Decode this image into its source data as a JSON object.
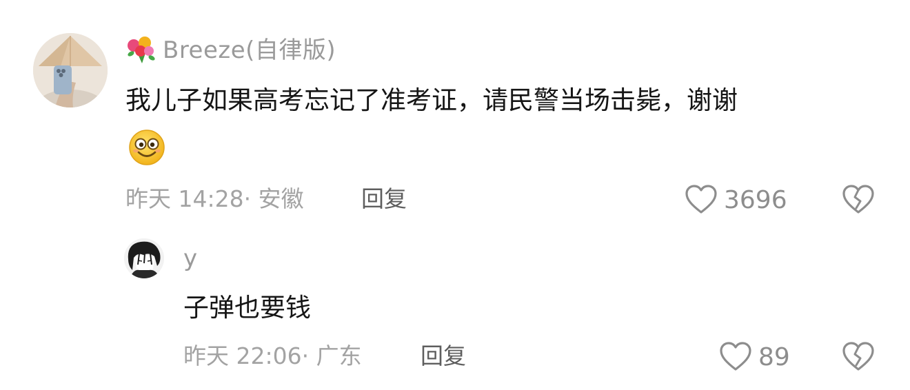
{
  "comment": {
    "username": "Breeze(自律版)",
    "badge_icon": "flower-bouquet-icon",
    "text": "我儿子如果高考忘记了准考证，请民警当场击毙，谢谢",
    "emoji_icon": "smiley-face-icon",
    "time": "昨天 14:28",
    "location": "· 安徽",
    "reply_label": "回复",
    "like_count": "3696",
    "like_icon": "heart-outline-icon",
    "dislike_icon": "broken-heart-icon"
  },
  "reply": {
    "username": "y",
    "text": "子弹也要钱",
    "time": "昨天 22:06",
    "location": "· 广东",
    "reply_label": "回复",
    "like_count": "89",
    "like_icon": "heart-outline-icon",
    "dislike_icon": "broken-heart-icon"
  },
  "colors": {
    "username": "#9a9a9a",
    "text": "#151515",
    "meta": "#a3a3a3",
    "icon": "#8d8d8d"
  }
}
